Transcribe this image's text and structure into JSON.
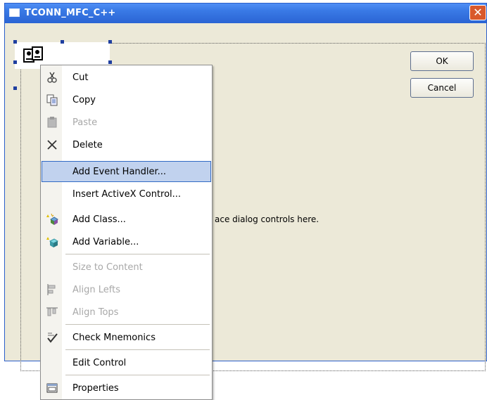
{
  "window": {
    "title": "TCONN_MFC_C++",
    "close_glyph": "✕"
  },
  "dialog": {
    "ok_label": "OK",
    "cancel_label": "Cancel",
    "placeholder_text": "ace dialog controls here."
  },
  "menu": {
    "items": [
      {
        "label": "Cut",
        "icon": "scissors-icon",
        "enabled": true
      },
      {
        "label": "Copy",
        "icon": "copy-icon",
        "enabled": true
      },
      {
        "label": "Paste",
        "icon": "paste-icon",
        "enabled": false
      },
      {
        "label": "Delete",
        "icon": "delete-x-icon",
        "enabled": true
      },
      {
        "label": "Add Event Handler...",
        "icon": "",
        "enabled": true,
        "highlighted": true
      },
      {
        "label": "Insert ActiveX Control...",
        "icon": "",
        "enabled": true
      },
      {
        "label": "Add Class...",
        "icon": "add-class-icon",
        "enabled": true
      },
      {
        "label": "Add Variable...",
        "icon": "add-variable-icon",
        "enabled": true
      },
      {
        "label": "Size to Content",
        "icon": "",
        "enabled": false
      },
      {
        "label": "Align Lefts",
        "icon": "align-lefts-icon",
        "enabled": false
      },
      {
        "label": "Align Tops",
        "icon": "align-tops-icon",
        "enabled": false
      },
      {
        "label": "Check Mnemonics",
        "icon": "check-mnemonics-icon",
        "enabled": true
      },
      {
        "label": "Edit Control",
        "icon": "",
        "enabled": true
      },
      {
        "label": "Properties",
        "icon": "properties-icon",
        "enabled": true
      }
    ]
  },
  "colors": {
    "titlebar": "#2a64d4",
    "highlight": "#c1d2ee",
    "highlight_border": "#316ac5",
    "dialog_bg": "#ece9d8",
    "close": "#d9592c"
  }
}
